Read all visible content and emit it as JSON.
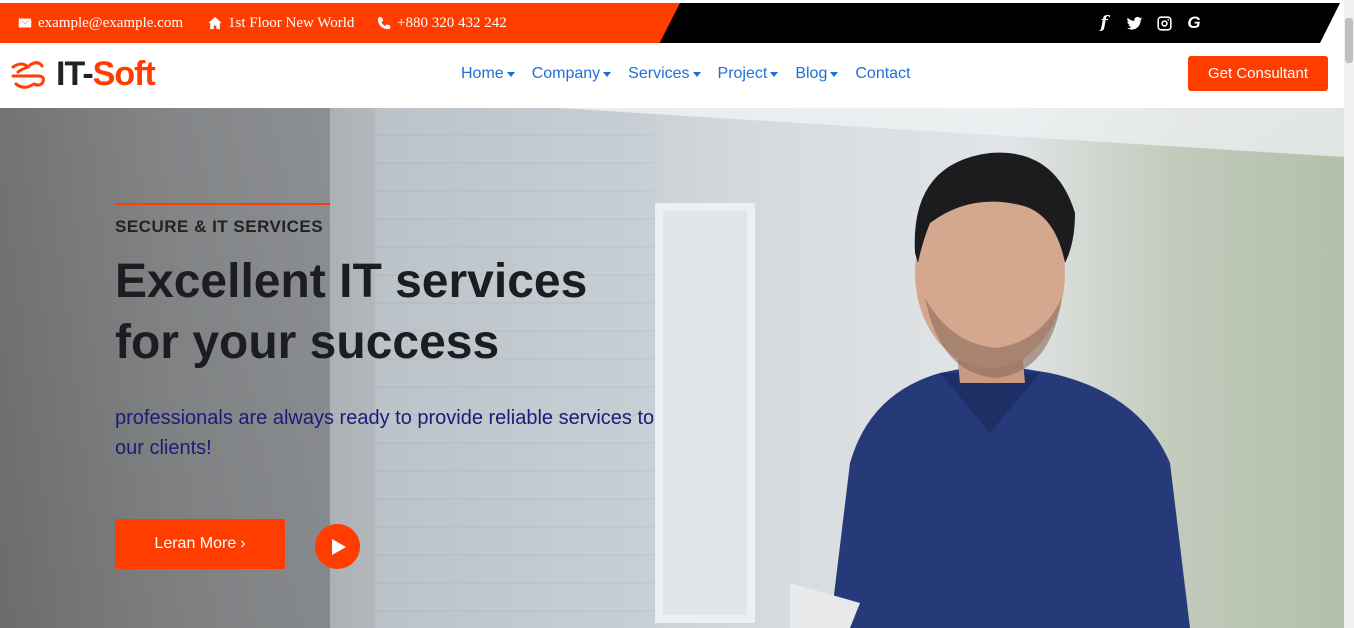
{
  "topbar": {
    "email": "example@example.com",
    "address": "1st Floor New World",
    "phone": "+880 320 432 242",
    "social_icons": [
      "facebook-icon",
      "twitter-icon",
      "instagram-icon",
      "google-icon"
    ]
  },
  "brand": {
    "name_prefix": "IT-",
    "name_suffix": "Soft",
    "accent_color": "#ff3d00",
    "link_color": "#1e6fd9"
  },
  "nav": {
    "items": [
      {
        "label": "Home",
        "dropdown": true
      },
      {
        "label": "Company",
        "dropdown": true
      },
      {
        "label": "Services",
        "dropdown": true
      },
      {
        "label": "Project",
        "dropdown": true
      },
      {
        "label": "Blog",
        "dropdown": true
      },
      {
        "label": "Contact",
        "dropdown": false
      }
    ],
    "cta_label": "Get Consultant"
  },
  "hero": {
    "eyebrow": "SECURE & IT SERVICES",
    "headline_line1": "Excellent IT services",
    "headline_line2": "for your success",
    "subtext": "professionals are always ready to provide reliable services to our clients!",
    "learn_more_label": "Leran More",
    "learn_more_suffix": "›"
  }
}
